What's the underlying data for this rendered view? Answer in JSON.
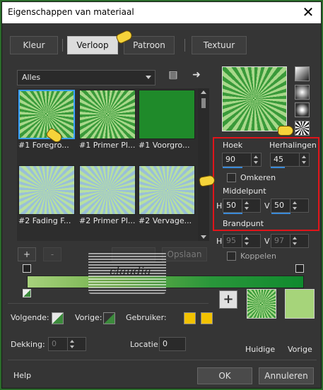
{
  "window": {
    "title": "Eigenschappen van materiaal",
    "close_glyph": "✕"
  },
  "tabs": [
    {
      "label": "Kleur"
    },
    {
      "label": "Verloop"
    },
    {
      "label": "Patroon"
    },
    {
      "label": "Textuur"
    }
  ],
  "category_select": {
    "value": "Alles"
  },
  "gradients": [
    {
      "label": "#1 Foregro..."
    },
    {
      "label": "#1 Primer Pl..."
    },
    {
      "label": "#1 Voorgro..."
    },
    {
      "label": "#2 Fading F..."
    },
    {
      "label": "#2 Primer Pl..."
    },
    {
      "label": "#2 Vervage..."
    }
  ],
  "params": {
    "hoek_label": "Hoek",
    "hoek_value": "90",
    "herhalingen_label": "Herhalingen",
    "herhalingen_value": "45",
    "omkeren_label": "Omkeren",
    "middelpunt_label": "Middelpunt",
    "h_label": "H",
    "h_value": "50",
    "v_label": "V",
    "v_value": "50",
    "brandpunt_label": "Brandpunt",
    "bh_label": "H",
    "bh_value": "95",
    "bv_label": "V",
    "bv_value": "97",
    "koppelen_label": "Koppelen"
  },
  "editor": {
    "add_label": "+",
    "remove_label": "-",
    "opslaan_label": "Opslaan"
  },
  "watermark": {
    "text": "claudia"
  },
  "bottom_fields": {
    "volgende_label": "Volgende:",
    "vorige_label": "Vorige:",
    "gebruiker_label": "Gebruiker:",
    "dekking_label": "Dekking:",
    "dekking_value": "0",
    "locatie_label": "Locatie:",
    "locatie_value": "0"
  },
  "previews": {
    "huidige_label": "Huidige",
    "vorige_label": "Vorige"
  },
  "footer": {
    "help_label": "Help",
    "ok_label": "OK",
    "cancel_label": "Annuleren"
  },
  "colors": {
    "accent": "#3a8ad8",
    "highlight_box": "#e0141a",
    "gradient_start": "#a7d17c",
    "gradient_end": "#108a2e",
    "user_swatch": "#f2c200"
  }
}
